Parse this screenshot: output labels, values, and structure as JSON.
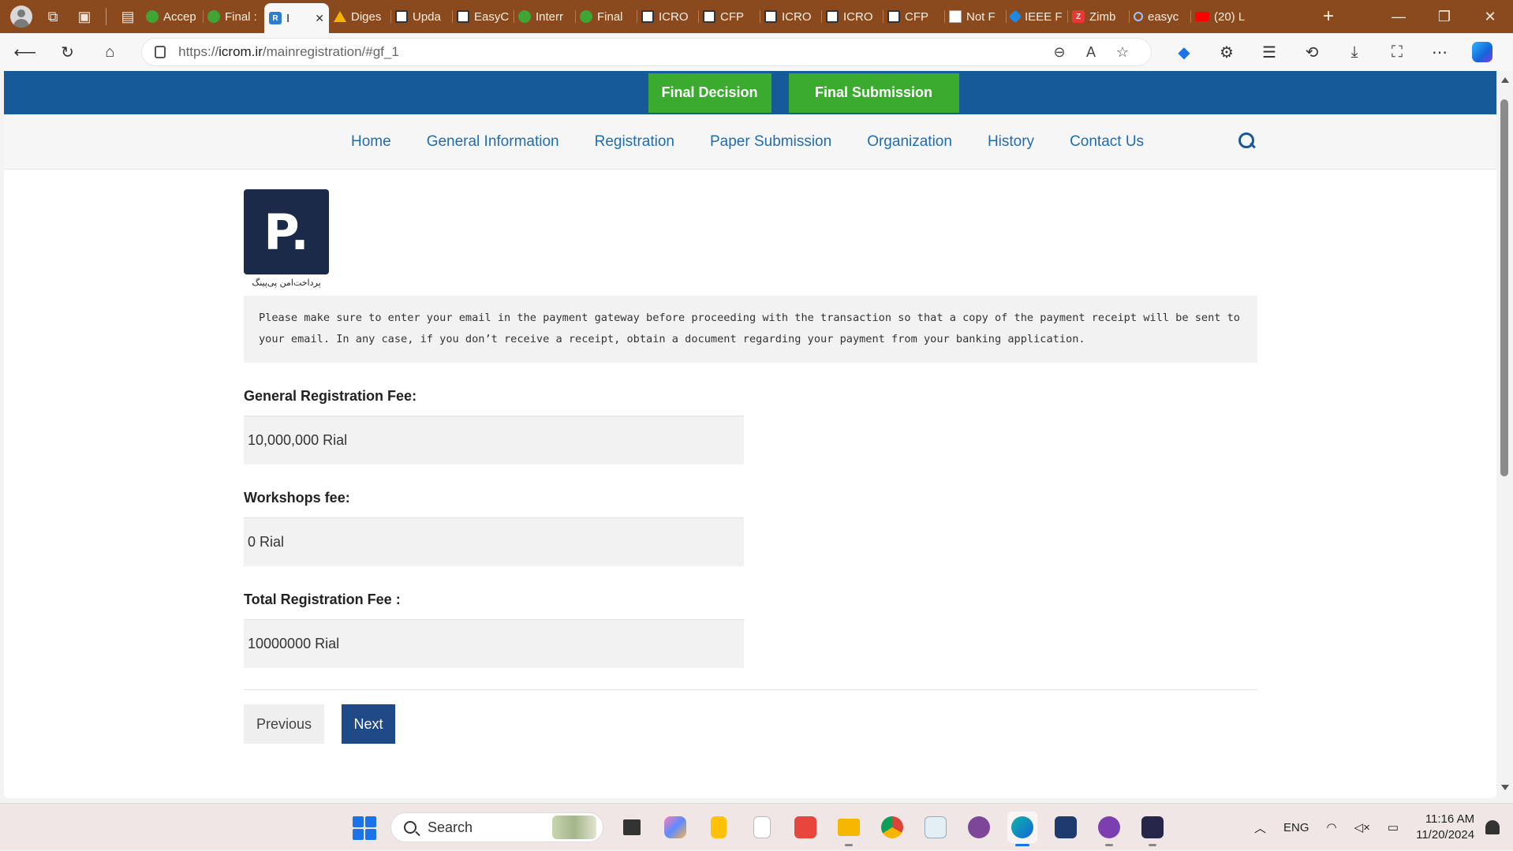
{
  "browser": {
    "tabs": [
      {
        "label": "Accep",
        "favicon": "green"
      },
      {
        "label": "Final :",
        "favicon": "green"
      },
      {
        "label": "I",
        "favicon": "rg",
        "active": true
      },
      {
        "label": "Diges",
        "favicon": "drive"
      },
      {
        "label": "Upda",
        "favicon": "doc"
      },
      {
        "label": "EasyC",
        "favicon": "doc"
      },
      {
        "label": "Interr",
        "favicon": "green"
      },
      {
        "label": "Final",
        "favicon": "green"
      },
      {
        "label": "ICRO",
        "favicon": "doc"
      },
      {
        "label": "CFP",
        "favicon": "doc"
      },
      {
        "label": "ICRO",
        "favicon": "doc"
      },
      {
        "label": "ICRO",
        "favicon": "doc"
      },
      {
        "label": "CFP",
        "favicon": "doc"
      },
      {
        "label": "Not F",
        "favicon": "file"
      },
      {
        "label": "IEEE F",
        "favicon": "ieee"
      },
      {
        "label": "Zimb",
        "favicon": "zimb"
      },
      {
        "label": "easyc",
        "favicon": "search"
      },
      {
        "label": "(20) L",
        "favicon": "yt"
      }
    ],
    "address": {
      "prefix": "https://",
      "host": "icrom.ir",
      "path": "/mainregistration/#gf_1"
    }
  },
  "site": {
    "top_buttons": {
      "final_decision": "Final Decision",
      "final_submission": "Final Submission"
    },
    "menu": [
      "Home",
      "General Information",
      "Registration",
      "Paper Submission",
      "Organization",
      "History",
      "Contact Us"
    ]
  },
  "form": {
    "logo_letter": "P.",
    "logo_caption": "پرداخت‌امن پی‌پینگ",
    "notice": "Please make sure to enter your email in the payment gateway before proceeding with the transaction so that a copy of the payment receipt will be sent to your email. In any case, if you don’t receive a receipt, obtain a document regarding your payment from your banking application.",
    "fields": [
      {
        "label": "General Registration Fee:",
        "value": "10,000,000 Rial"
      },
      {
        "label": "Workshops fee:",
        "value": "0 Rial"
      },
      {
        "label": "Total Registration Fee :",
        "value": "10000000 Rial"
      }
    ],
    "previous_label": "Previous",
    "next_label": "Next"
  },
  "taskbar": {
    "search_label": "Search",
    "language": "ENG",
    "time": "11:16 AM",
    "date": "11/20/2024"
  },
  "colors": {
    "site_header": "#175a9a",
    "green_button": "#3aab2f",
    "next_button": "#1f4a87",
    "menu_link": "#1f6cb0",
    "tabbar": "#8a4a1d"
  }
}
